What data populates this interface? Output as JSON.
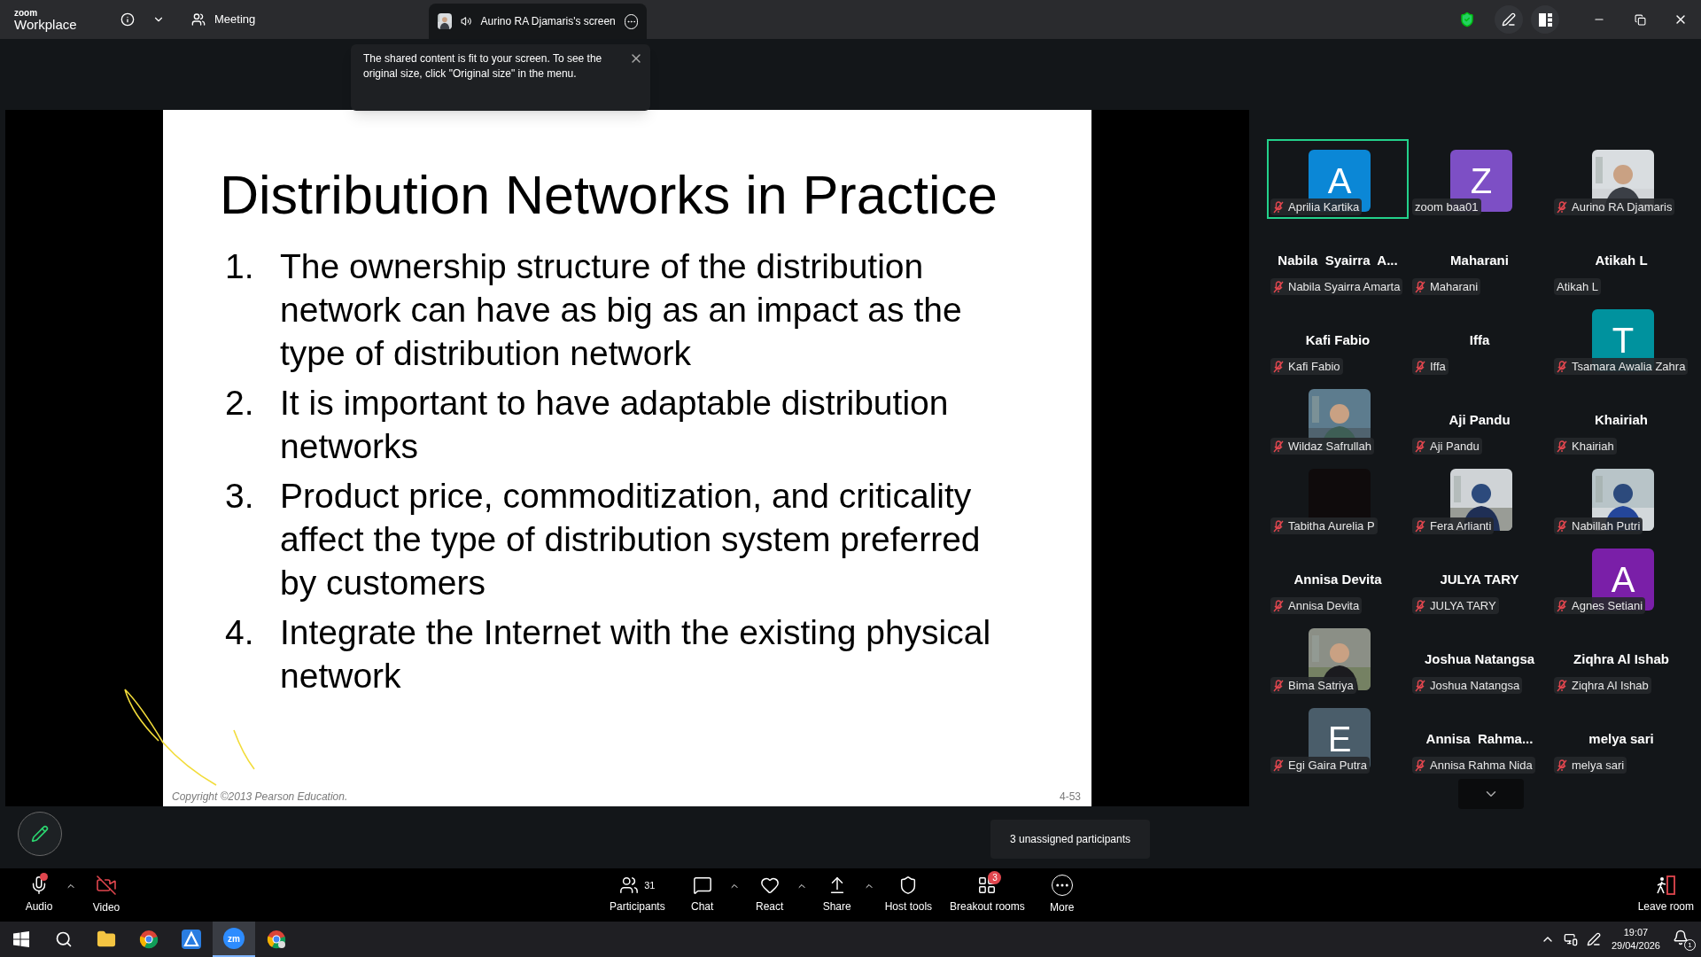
{
  "app": {
    "brand_small": "zoom",
    "brand": "Workplace",
    "meeting_label": "Meeting",
    "share_tab": {
      "title": "Aurino RA Djamaris's screen"
    }
  },
  "notice": {
    "text": "The shared content is fit to your screen. To see the original size, click \"Original size\" in the menu."
  },
  "slide": {
    "title": "Distribution Networks in Practice",
    "items": [
      {
        "number": "1.",
        "text": "The ownership structure of the distribution network can have as big as an impact as the type of distribution network"
      },
      {
        "number": "2.",
        "text": "It is important to have adaptable distribution networks"
      },
      {
        "number": "3.",
        "text": "Product price, commoditization, and criticality affect the type of distribution system preferred by customers"
      },
      {
        "number": "4.",
        "text": "Integrate the Internet with the existing physical network"
      }
    ],
    "copyright": "Copyright ©2013 Pearson Education.",
    "page": "4-53"
  },
  "participants": [
    {
      "kind": "avatar",
      "letter": "A",
      "color": "#0b87d6",
      "label": "Aprilia Kartika",
      "muted": true,
      "speaking": true
    },
    {
      "kind": "avatar",
      "letter": "Z",
      "color": "#7d4fc5",
      "label": "zoom baa01",
      "muted": false,
      "speaking": false
    },
    {
      "label": "Aurino RA Djamaris",
      "muted": true,
      "speaking": false
    },
    {
      "kind": "name",
      "display_name": "Nabila  Syairra  A...",
      "label": "Nabila Syairra Amarta",
      "muted": true,
      "speaking": false
    },
    {
      "kind": "name",
      "display_name": "Maharani",
      "label": "Maharani",
      "muted": true,
      "speaking": false
    },
    {
      "kind": "name",
      "display_name": "Atikah L",
      "label": "Atikah L",
      "muted": false,
      "speaking": false
    },
    {
      "kind": "name",
      "display_name": "Kafi Fabio",
      "label": "Kafi Fabio",
      "muted": true,
      "speaking": false
    },
    {
      "kind": "name",
      "display_name": "Iffa",
      "label": "Iffa",
      "muted": true,
      "speaking": false
    },
    {
      "kind": "avatar",
      "letter": "T",
      "color": "#00929e",
      "label": "Tsamara Awalia Zahra",
      "muted": true,
      "speaking": false
    },
    {
      "label": "Wildaz Safrullah",
      "muted": true,
      "speaking": false
    },
    {
      "kind": "name",
      "display_name": "Aji Pandu",
      "label": "Aji Pandu",
      "muted": true,
      "speaking": false
    },
    {
      "kind": "name",
      "display_name": "Khairiah",
      "label": "Khairiah",
      "muted": true,
      "speaking": false
    },
    {
      "kind": "dark",
      "label": "Tabitha Aurelia P",
      "muted": true,
      "speaking": false
    },
    {
      "label": "Fera Arlianti",
      "muted": true,
      "speaking": false
    },
    {
      "label": "Nabillah Putri",
      "muted": true,
      "speaking": false
    },
    {
      "kind": "name",
      "display_name": "Annisa Devita",
      "label": "Annisa Devita",
      "muted": true,
      "speaking": false
    },
    {
      "kind": "name",
      "display_name": "JULYA TARY",
      "label": "JULYA TARY",
      "muted": true,
      "speaking": false
    },
    {
      "kind": "avatar",
      "letter": "A",
      "color": "#7a1fa8",
      "label": "Agnes Setiani",
      "muted": true,
      "speaking": false
    },
    {
      "label": "Bima Satriya",
      "muted": true,
      "speaking": false
    },
    {
      "kind": "name",
      "display_name": "Joshua Natangsa",
      "label": "Joshua Natangsa",
      "muted": true,
      "speaking": false
    },
    {
      "kind": "name",
      "display_name": "Ziqhra Al Ishab",
      "label": "Ziqhra Al Ishab",
      "muted": true,
      "speaking": false
    },
    {
      "kind": "avatar",
      "letter": "E",
      "color": "#4a5d6a",
      "label": "Egi Gaira Putra",
      "muted": true,
      "speaking": false
    },
    {
      "kind": "name",
      "display_name": "Annisa  Rahma...",
      "label": "Annisa Rahma Nida",
      "muted": true,
      "speaking": false
    },
    {
      "kind": "name",
      "display_name": "melya sari",
      "label": "melya sari",
      "muted": true,
      "speaking": false
    }
  ],
  "unassigned_tip": "3 unassigned participants",
  "toolbar": [
    {
      "kind": "audio",
      "label": "Audio",
      "caret": true
    },
    {
      "kind": "video",
      "label": "Video",
      "caret": false
    },
    {
      "kind": "participants",
      "label": "Participants",
      "count": "31",
      "caret": false
    },
    {
      "kind": "chat",
      "label": "Chat",
      "caret": true
    },
    {
      "kind": "react",
      "label": "React",
      "caret": true
    },
    {
      "kind": "share",
      "label": "Share",
      "caret": true
    },
    {
      "kind": "host",
      "label": "Host tools",
      "caret": false
    },
    {
      "kind": "breakout",
      "label": "Breakout rooms",
      "badge": "3",
      "caret": false
    },
    {
      "kind": "more",
      "label": "More",
      "caret": false
    }
  ],
  "leave": {
    "label": "Leave room"
  },
  "taskbar": {
    "apps": [
      {
        "kind": "windows",
        "selected": false
      },
      {
        "kind": "search",
        "selected": false
      },
      {
        "kind": "folder",
        "selected": false
      },
      {
        "kind": "chrome",
        "selected": false
      },
      {
        "kind": "triangle",
        "selected": false
      },
      {
        "kind": "zoom",
        "label": "zm",
        "selected": true
      },
      {
        "kind": "chrome2",
        "selected": false
      }
    ],
    "time": "19:07",
    "date": "29/04/2026",
    "notifications": "1"
  }
}
